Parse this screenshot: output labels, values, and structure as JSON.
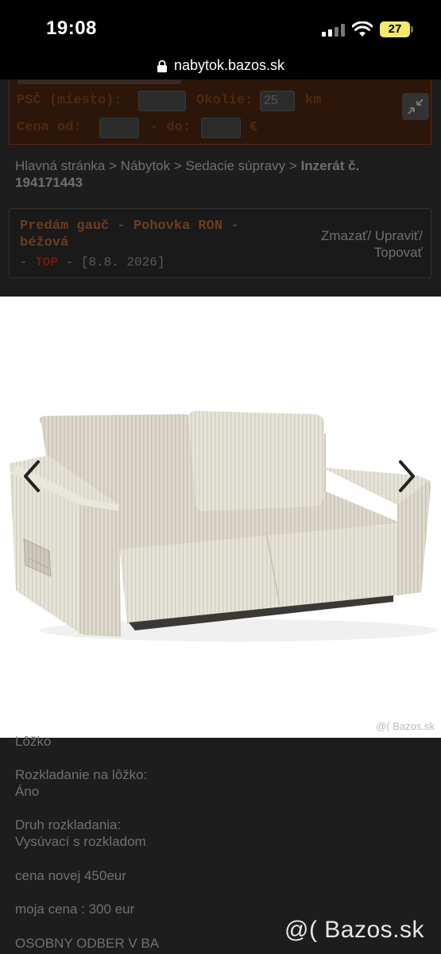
{
  "status_bar": {
    "time": "19:08",
    "battery": "27"
  },
  "browser": {
    "url": "nabytok.bazos.sk"
  },
  "search": {
    "psc_label": "PSČ (miesto):",
    "okolie_label": "Okolie:",
    "okolie_value": "25",
    "km_label": "km",
    "cena_label": "Cena od:",
    "do_label": "- do:",
    "currency": "€"
  },
  "breadcrumb": {
    "path": "Hlavná stránka > Nábytok > Sedacie súpravy > ",
    "current": "Inzerát č. 194171443"
  },
  "listing": {
    "title": "Predám gauč - Pohovka RON - béžová",
    "meta_prefix": "- ",
    "top_label": "TOP",
    "meta_date": " - [8.8. 2026]",
    "actions": "Zmazať/ Upraviť/ Topovať"
  },
  "lightbox": {
    "watermark": "@( Bazos.sk"
  },
  "description": {
    "line_lozko": "Lôžko",
    "rozkladanie_label": "Rozkladanie na lôžko:",
    "rozkladanie_value": "Áno",
    "druh_label": "Druh rozkladania:",
    "druh_value": "Vysúvací s rozkladom",
    "cena_novej": "cena novej 450eur",
    "moja_cena": "moja cena : 300 eur",
    "osobny": "OSOBNY ODBER V BA"
  },
  "footer": {
    "watermark": "@( Bazos.sk"
  },
  "colors": {
    "accent_dark": "#2b1609",
    "title_brown": "#6b3d1f",
    "top_red": "#6e1a14",
    "battery_yellow": "#f3e96a"
  }
}
